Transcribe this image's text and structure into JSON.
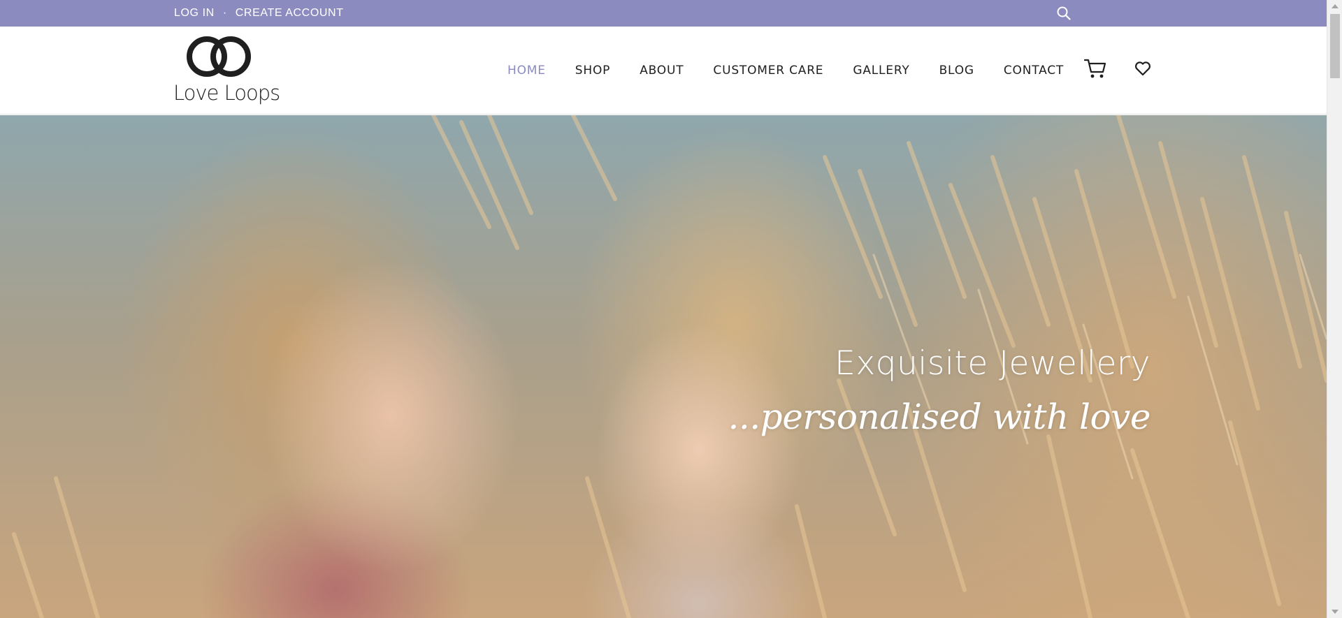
{
  "topbar": {
    "login_label": "LOG IN",
    "separator": "·",
    "create_account_label": "CREATE ACCOUNT",
    "search_icon": "search-icon",
    "background_color": "#8b8bc0"
  },
  "header": {
    "logo_text": "Love Loops",
    "logo_icon": "interlocking-rings-logo",
    "nav": [
      {
        "label": "HOME",
        "active": true
      },
      {
        "label": "SHOP",
        "active": false
      },
      {
        "label": "ABOUT",
        "active": false
      },
      {
        "label": "CUSTOMER CARE",
        "active": false
      },
      {
        "label": "GALLERY",
        "active": false
      },
      {
        "label": "BLOG",
        "active": false
      },
      {
        "label": "CONTACT",
        "active": false
      }
    ],
    "cart_icon": "cart-icon",
    "wishlist_icon": "heart-icon",
    "accent_color": "#8b8bc0"
  },
  "hero": {
    "headline": "Exquisite Jewellery",
    "tagline": "...personalised with love"
  }
}
